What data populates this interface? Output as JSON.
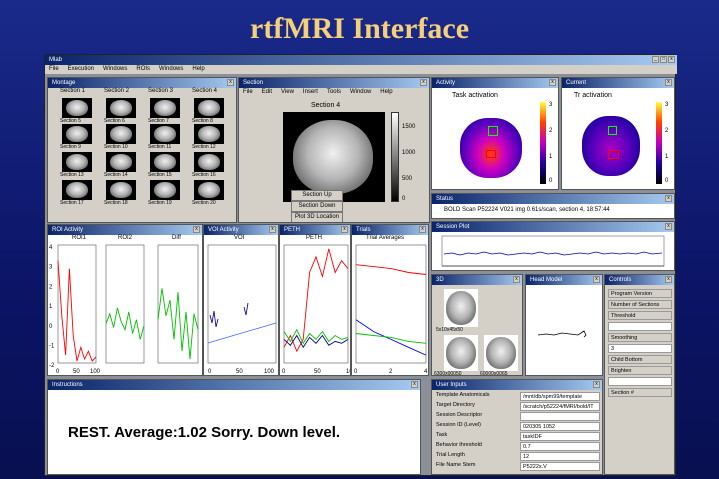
{
  "slide": {
    "title": "rtfMRI Interface"
  },
  "main_window": {
    "title": "Mlab",
    "menu": [
      "File",
      "Execution",
      "Windows",
      "ROIs",
      "Windows",
      "Help"
    ]
  },
  "montage": {
    "title": "Montage",
    "section_labels": [
      "Section 1",
      "Section 2",
      "Section 3",
      "Section 4"
    ],
    "row_labels": [
      [
        "Section 5",
        "Section 6",
        "Section 7",
        "Section 8"
      ],
      [
        "Section 9",
        "Section 10",
        "Section 11",
        "Section 12"
      ],
      [
        "Section 13",
        "Section 14",
        "Section 15",
        "Section 16"
      ],
      [
        "Section 17",
        "Section 18",
        "Section 19",
        "Section 20"
      ]
    ]
  },
  "section": {
    "title": "Section",
    "menu": [
      "File",
      "Edit",
      "View",
      "Insert",
      "Tools",
      "Window",
      "Help"
    ],
    "image_title": "Section 4",
    "colorbar_ticks": [
      "1500",
      "1000",
      "500",
      "0"
    ],
    "buttons": {
      "up": "Section Up",
      "down": "Section Down",
      "plot3d": "Plot 3D Location"
    }
  },
  "activity1": {
    "title": "Activity",
    "image_title": "Task activation",
    "colorbar_ticks": [
      "3",
      "2",
      "1",
      "0"
    ]
  },
  "activity2": {
    "title": "Current",
    "image_title": "Tr activation",
    "colorbar_ticks": [
      "3",
      "2",
      "1",
      "0"
    ]
  },
  "status": {
    "title": "Status",
    "text": "BOLD Scan P52224 V021 img 0.61s/scan, section 4, 18:57:44"
  },
  "session_plot": {
    "title": "Session Plot"
  },
  "roi_activity": {
    "title": "ROI Activity",
    "panels": [
      "ROI1",
      "ROI2",
      "Diff"
    ],
    "yticks": [
      "4",
      "3",
      "2",
      "1",
      "0",
      "-1",
      "-2"
    ],
    "xticks": [
      "0",
      "50",
      "100"
    ]
  },
  "voi": {
    "title": "VOI Activity",
    "panel": "VOI",
    "xticks": [
      "0",
      "50",
      "100"
    ]
  },
  "peth": {
    "title": "PETH",
    "panel": "PETH",
    "xticks": [
      "0",
      "50",
      "100"
    ]
  },
  "trial": {
    "title": "Trials",
    "panel": "Trial Averages",
    "xticks": [
      "0",
      "2",
      "4"
    ]
  },
  "three_d": {
    "title": "3D",
    "labels": [
      "5",
      "10",
      "15",
      "50",
      "100"
    ],
    "captions": [
      "5x10x45x50",
      "6300x00050",
      "60000x0065"
    ]
  },
  "head_model": {
    "title": "Head Model"
  },
  "controls": {
    "title": "Controls",
    "items": [
      "Program Version",
      "Number of Sections",
      "Threshold",
      "Smoothing",
      "3",
      "Child Bottom",
      "Brighten",
      "Section #"
    ]
  },
  "instructions": {
    "title": "Instructions",
    "message": "REST. Average:1.02 Sorry. Down level."
  },
  "user_inputs": {
    "title": "User Inputs",
    "rows": [
      {
        "label": "Template Anatomicals",
        "value": "/mnt/db/spm99/template"
      },
      {
        "label": "Target Directory",
        "value": "/scratch/p52224/fMRI/bold/IT"
      },
      {
        "label": "Session Descriptor",
        "value": ""
      },
      {
        "label": "Session ID (Level)",
        "value": "020305 1052"
      },
      {
        "label": "Task",
        "value": "taskIDF"
      },
      {
        "label": "Behavior threshold",
        "value": "0.7"
      },
      {
        "label": "Trial Length",
        "value": "12"
      },
      {
        "label": "File Name Stem",
        "value": "P5222x.V"
      }
    ]
  },
  "chart_data": [
    {
      "type": "line",
      "title": "ROI1",
      "x": [
        0,
        10,
        20,
        30,
        40,
        50,
        60,
        70,
        80,
        90,
        100
      ],
      "series": [
        {
          "values": [
            3.2,
            0.4,
            -1.6,
            2.8,
            -0.6,
            -1.9,
            -1.2,
            -1.8,
            -1.4,
            -1.9,
            -1.7
          ]
        }
      ]
    },
    {
      "type": "line",
      "title": "ROI2",
      "x": [
        0,
        10,
        20,
        30,
        40,
        50,
        60,
        70,
        80,
        90,
        100
      ],
      "series": [
        {
          "values": [
            0,
            0.5,
            -0.2,
            0.8,
            0.1,
            -0.3,
            0.6,
            -0.5,
            0.2,
            -0.8,
            -0.1
          ]
        }
      ]
    },
    {
      "type": "line",
      "title": "Diff",
      "x": [
        0,
        10,
        20,
        30,
        40,
        50,
        60,
        70,
        80,
        90,
        100
      ],
      "series": [
        {
          "values": [
            0.2,
            1.8,
            0.4,
            1.2,
            -0.8,
            1.6,
            -1.4,
            0.6,
            -1.8,
            0.5,
            -0.3
          ]
        }
      ]
    },
    {
      "type": "line",
      "title": "PETH",
      "x": [
        0,
        10,
        20,
        30,
        40,
        50,
        60,
        70,
        80,
        90,
        100
      ],
      "series": [
        {
          "values": [
            -1.2,
            -0.6,
            -1.4,
            -0.8,
            2.6,
            3.4,
            2.4,
            3.8,
            2.6,
            3.2,
            2.8
          ]
        },
        {
          "values": [
            -0.4,
            -0.9,
            -0.3,
            -1.0,
            -0.5,
            -0.8,
            -0.4,
            -0.9,
            -0.6,
            -0.8,
            -0.7
          ]
        },
        {
          "values": [
            -0.8,
            -1.1,
            -0.6,
            -1.2,
            -0.7,
            -1.0,
            -0.6,
            -1.1,
            -0.9,
            -1.0,
            -0.8
          ]
        }
      ]
    },
    {
      "type": "line",
      "title": "Trial Averages",
      "x": [
        0,
        1,
        2,
        3,
        4
      ],
      "series": [
        {
          "values": [
            3.0,
            2.9,
            2.8,
            2.6,
            2.5
          ]
        },
        {
          "values": [
            0.2,
            -0.4,
            -0.8,
            -1.2,
            -1.6
          ]
        },
        {
          "values": [
            -0.5,
            -0.6,
            -0.7,
            -0.9,
            -1.0
          ]
        }
      ]
    }
  ]
}
